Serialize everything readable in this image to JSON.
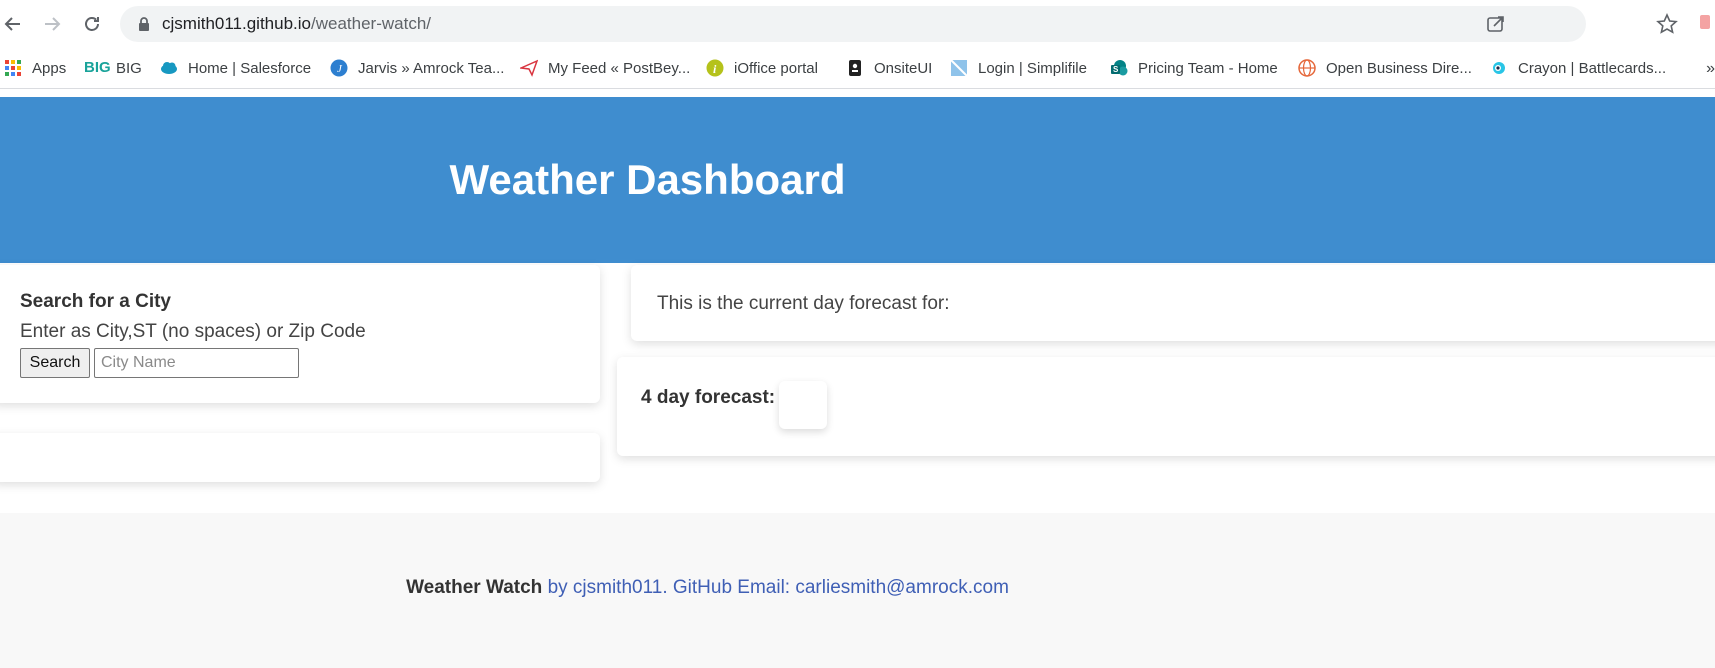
{
  "browser": {
    "url_host": "cjsmith011.github.io",
    "url_path": "/weather-watch/",
    "bookmarks": [
      {
        "label": "Apps",
        "icon": "apps-grid-icon"
      },
      {
        "label": "BIG",
        "icon": "big-logo-icon"
      },
      {
        "label": "Home | Salesforce",
        "icon": "salesforce-cloud-icon"
      },
      {
        "label": "Jarvis » Amrock Tea...",
        "icon": "jarvis-icon"
      },
      {
        "label": "My Feed « PostBey...",
        "icon": "paper-plane-icon"
      },
      {
        "label": "iOffice portal",
        "icon": "info-icon"
      },
      {
        "label": "OnsiteUI",
        "icon": "badge-icon"
      },
      {
        "label": "Login | Simplifile",
        "icon": "simplifile-icon"
      },
      {
        "label": "Pricing Team - Home",
        "icon": "sharepoint-icon"
      },
      {
        "label": "Open Business Dire...",
        "icon": "globe-icon"
      },
      {
        "label": "Crayon | Battlecards...",
        "icon": "crayon-icon"
      }
    ],
    "more": "»"
  },
  "header": {
    "title": "Weather Dashboard"
  },
  "search": {
    "title": "Search for a City",
    "hint": "Enter as City,ST (no spaces) or Zip Code",
    "button_label": "Search",
    "placeholder": "City Name",
    "value": ""
  },
  "current": {
    "text": "This is the current day forecast for:"
  },
  "forecast": {
    "label": "4 day forecast:"
  },
  "footer": {
    "brand": "Weather Watch",
    "byline": "by cjsmith011. GitHub Email: carliesmith@amrock.com"
  },
  "colors": {
    "header_bg": "#3f8dcf",
    "link": "#3f5fb5",
    "footer_bg": "#f8f8f8"
  }
}
